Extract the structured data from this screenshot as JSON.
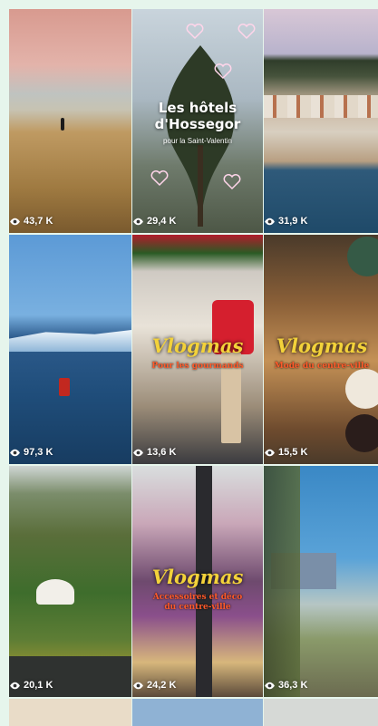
{
  "tiles": [
    {
      "views": "43,7 K"
    },
    {
      "views": "29,4 K",
      "title_line1": "Les hôtels",
      "title_line2": "d'Hossegor",
      "subtitle": "pour la Saint-Valentin"
    },
    {
      "views": "31,9 K"
    },
    {
      "views": "97,3 K"
    },
    {
      "views": "13,6 K",
      "title": "Vlogmas",
      "subtitle": "Pour les gourmands"
    },
    {
      "views": "15,5 K",
      "title": "Vlogmas",
      "subtitle": "Mode du centre-ville"
    },
    {
      "views": "20,1 K"
    },
    {
      "views": "24,2 K",
      "title": "Vlogmas",
      "subtitle_line1": "Accessoires et déco",
      "subtitle_line2": "du centre-ville"
    },
    {
      "views": "36,3 K"
    },
    {},
    {},
    {}
  ],
  "icons": {
    "views": "eye-icon",
    "like": "heart-icon"
  },
  "colors": {
    "background": "#e6f5ec",
    "vlog_title": "#f3d23a",
    "vlog_sub": "#ff5a2a"
  }
}
